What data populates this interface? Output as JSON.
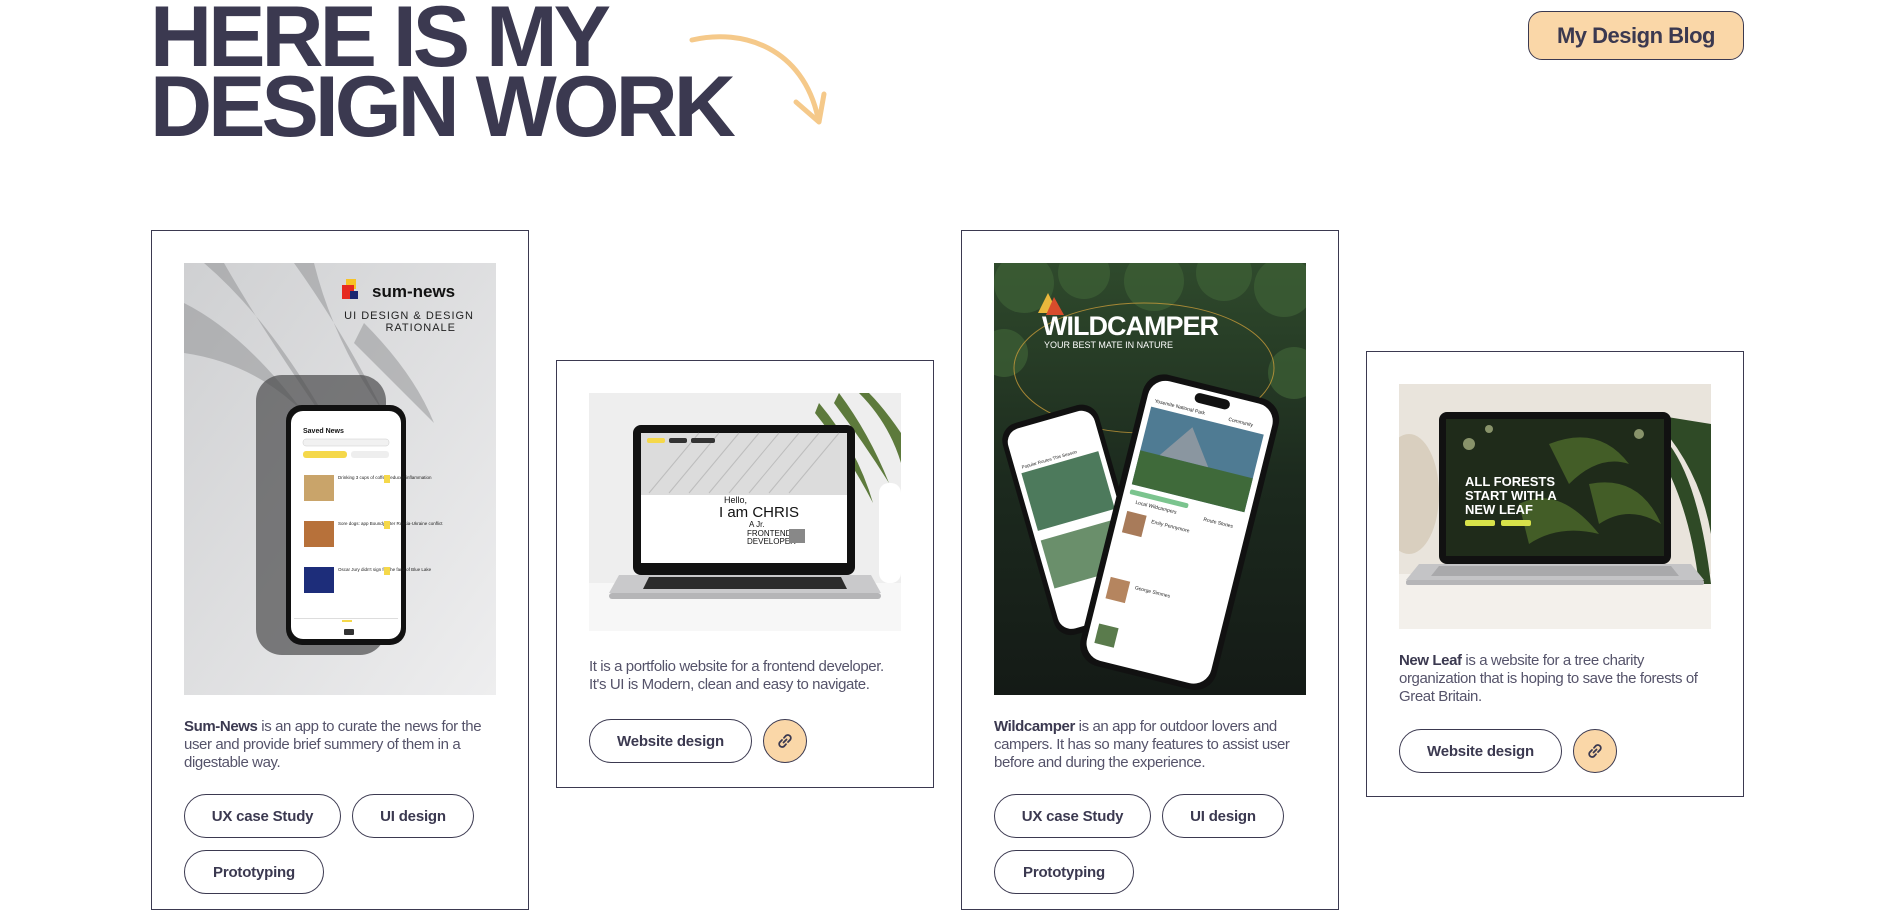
{
  "hero": {
    "line1": "HERE IS MY",
    "line2": "DESIGN WORK"
  },
  "header": {
    "blog_button": "My Design Blog"
  },
  "colors": {
    "ink": "#3b3950",
    "accent": "#fad7a8",
    "arrow": "#f5c98a"
  },
  "projects": [
    {
      "name": "Sum-News",
      "description": " is an app to curate the news for the user and provide brief summery of them in a digestable way.",
      "mockup": {
        "logo": "sum-news",
        "subtitle_1": "UI DESIGN & DESIGN",
        "subtitle_2": "RATIONALE",
        "screen_title": "Saved News",
        "item_1": "Drinking 3 cups of coffee reduces inflammation",
        "item_2": "Sore dogs: app Boundy after Russia-Ukraine conflict",
        "item_3": "Oscar Jury didn't sign for the fans of Blue Lake"
      },
      "tags": [
        "UX case Study",
        "UI design",
        "Prototyping"
      ]
    },
    {
      "name": "",
      "description": "It is a portfolio website for a frontend developer. It's UI is Modern, clean and easy to navigate.",
      "mockup": {
        "hello": "Hello,",
        "name": "I am CHRIS",
        "role_1": "A Jr.",
        "role_2": "FRONTEND",
        "role_3": "DEVELOPER"
      },
      "tags": [
        "Website design"
      ]
    },
    {
      "name": "Wildcamper",
      "description": " is an app for outdoor lovers and campers. It has so many features to assist user before and during the experience.",
      "mockup": {
        "brand": "WILDCAMPER",
        "tagline": "YOUR BEST MATE IN NATURE",
        "park": "Yosemite National Park",
        "community": "Community",
        "section": "Local Wildcampers",
        "tab": "Route Stories",
        "user_1": "Emily Pennymore",
        "user_2": "George Simmes",
        "popular": "Popular Routes This Season"
      },
      "tags": [
        "UX case Study",
        "UI design",
        "Prototyping"
      ]
    },
    {
      "name": "New Leaf",
      "description": " is a website for a tree charity organization that is hoping to save the forests of Great Britain.",
      "mockup": {
        "headline_1": "ALL FORESTS",
        "headline_2": "START WITH A",
        "headline_3": "NEW LEAF"
      },
      "tags": [
        "Website design"
      ]
    }
  ],
  "icons": {
    "link": "link-icon",
    "arrow": "curved-arrow-icon"
  }
}
